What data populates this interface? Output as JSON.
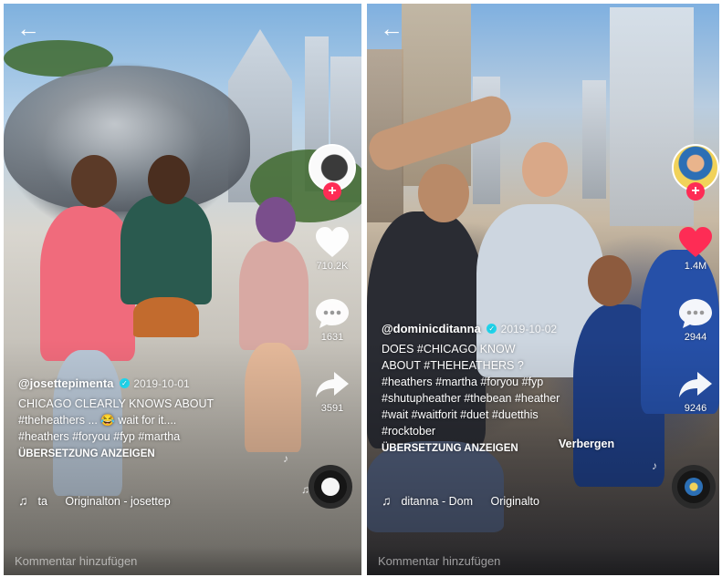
{
  "screens": [
    {
      "author": "@josettepimenta",
      "date": "2019-10-01",
      "caption_lines": [
        "CHICAGO CLEARLY KNOWS ABOUT",
        "#theheathers ... 😂 wait for it....",
        "#heathers #foryou #fyp #martha"
      ],
      "translate_label": "ÜBERSETZUNG ANZEIGEN",
      "music_left": "ta",
      "music_right": "Originalton - josettep",
      "likes": "710.2K",
      "comments": "1631",
      "shares": "3591",
      "comment_placeholder": "Kommentar hinzufügen"
    },
    {
      "author": "@dominicditanna",
      "date": "2019-10-02",
      "caption_lines": [
        "DOES #CHICAGO KNOW",
        "ABOUT #THEHEATHERS ?",
        "#heathers #martha #foryou #fyp",
        "#shutupheather #thebean #heather",
        "#wait #waitforit #duet #duetthis",
        "#rocktober"
      ],
      "hide_label": "Verbergen",
      "translate_label": "ÜBERSETZUNG ANZEIGEN",
      "music_left": "ditanna - Dom",
      "music_right": "Originalto",
      "likes": "1.4M",
      "comments": "2944",
      "shares": "9246",
      "comment_placeholder": "Kommentar hinzufügen"
    }
  ],
  "colors": {
    "accent": "#fe2c55",
    "liked": "#fe2c55",
    "verified": "#20d5ec"
  },
  "icons": [
    "back-arrow-icon",
    "plus-icon",
    "heart-icon",
    "comment-icon",
    "share-icon",
    "music-note-icon",
    "verified-icon"
  ]
}
